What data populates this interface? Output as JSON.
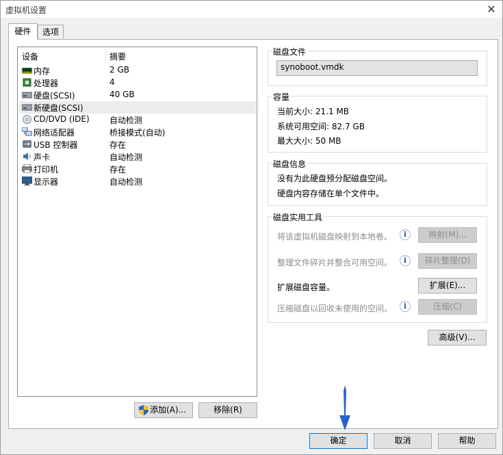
{
  "window": {
    "title": "虚拟机设置",
    "close_glyph": "✕"
  },
  "tabs": [
    {
      "label": "硬件",
      "selected": true
    },
    {
      "label": "选项",
      "selected": false
    }
  ],
  "device_list": {
    "headers": {
      "device": "设备",
      "summary": "摘要"
    },
    "items": [
      {
        "icon": "memory-icon",
        "name": "内存",
        "summary": "2 GB"
      },
      {
        "icon": "processor-icon",
        "name": "处理器",
        "summary": "4"
      },
      {
        "icon": "hard-disk-icon",
        "name": "硬盘(SCSI)",
        "summary": "40 GB"
      },
      {
        "icon": "hard-disk-icon",
        "name": "新硬盘(SCSI)",
        "summary": "",
        "selected": true
      },
      {
        "icon": "cd-dvd-icon",
        "name": "CD/DVD (IDE)",
        "summary": "自动检测"
      },
      {
        "icon": "network-adapter-icon",
        "name": "网络适配器",
        "summary": "桥接模式(自动)"
      },
      {
        "icon": "usb-icon",
        "name": "USB 控制器",
        "summary": "存在"
      },
      {
        "icon": "sound-card-icon",
        "name": "声卡",
        "summary": "自动检测"
      },
      {
        "icon": "printer-icon",
        "name": "打印机",
        "summary": "存在"
      },
      {
        "icon": "display-icon",
        "name": "显示器",
        "summary": "自动检测"
      }
    ]
  },
  "list_buttons": {
    "add": "添加(A)...",
    "remove": "移除(R)"
  },
  "disk_file": {
    "title": "磁盘文件",
    "value": "synoboot.vmdk"
  },
  "capacity": {
    "title": "容量",
    "current_size": "当前大小: 21.1 MB",
    "system_free": "系统可用空间: 82.7 GB",
    "max_size": "最大大小: 50 MB"
  },
  "disk_info": {
    "title": "磁盘信息",
    "line1": "没有为此硬盘预分配磁盘空间。",
    "line2": "硬盘内容存储在单个文件中。"
  },
  "disk_utilities": {
    "title": "磁盘实用工具",
    "map_desc": "将该虚拟机磁盘映射到本地卷。",
    "map_button": "映射(M)...",
    "defrag_desc": "整理文件碎片并整合可用空间。",
    "defrag_button": "碎片整理(D)",
    "expand_desc": "扩展磁盘容量。",
    "expand_button": "扩展(E)...",
    "compact_desc": "压缩磁盘以回收未使用的空间。",
    "compact_button": "压缩(C)",
    "info_glyph": "i"
  },
  "advanced_button": "高级(V)...",
  "footer": {
    "ok": "确定",
    "cancel": "取消",
    "help": "帮助"
  },
  "colors": {
    "arrow": "#2a62c9",
    "selection": "#ececec",
    "focus": "#0078d7"
  }
}
